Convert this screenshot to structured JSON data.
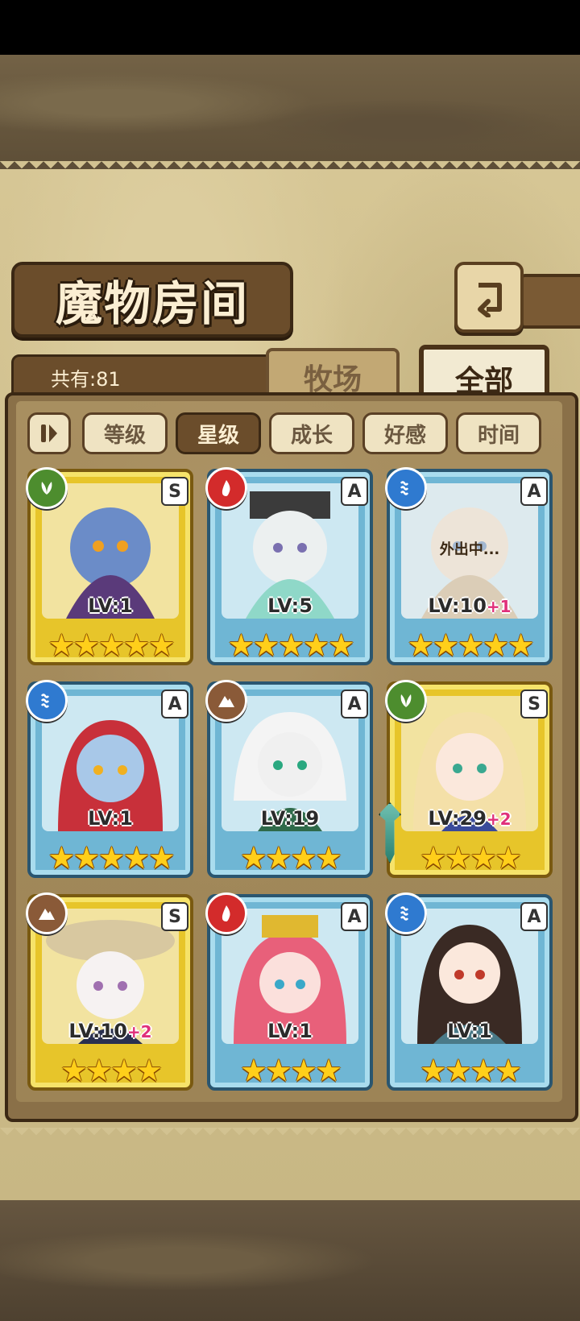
{
  "header": {
    "title": "魔物房间"
  },
  "count_label": "共有:81",
  "tabs": [
    {
      "label": "牧场",
      "active": false
    },
    {
      "label": "全部",
      "active": true
    }
  ],
  "sort_buttons": [
    {
      "label": "等级",
      "active": false
    },
    {
      "label": "星级",
      "active": true
    },
    {
      "label": "成长",
      "active": false
    },
    {
      "label": "好感",
      "active": false
    },
    {
      "label": "时间",
      "active": false
    }
  ],
  "monsters": [
    {
      "element": "grass",
      "rank": "S",
      "frame": "gold",
      "level": "LV:1",
      "plus": "",
      "stars": 5,
      "status": ""
    },
    {
      "element": "fire",
      "rank": "A",
      "frame": "blue",
      "level": "LV:5",
      "plus": "",
      "stars": 5,
      "status": ""
    },
    {
      "element": "water",
      "rank": "A",
      "frame": "blue",
      "level": "LV:10",
      "plus": "+1",
      "stars": 5,
      "status": "外出中..."
    },
    {
      "element": "water",
      "rank": "A",
      "frame": "blue",
      "level": "LV:1",
      "plus": "",
      "stars": 5,
      "status": ""
    },
    {
      "element": "earth",
      "rank": "A",
      "frame": "blue",
      "level": "LV:19",
      "plus": "",
      "stars": 4,
      "status": ""
    },
    {
      "element": "grass",
      "rank": "S",
      "frame": "gold",
      "level": "LV:29",
      "plus": "+2",
      "stars": 4,
      "status": ""
    },
    {
      "element": "earth",
      "rank": "S",
      "frame": "gold",
      "level": "LV:10",
      "plus": "+2",
      "stars": 4,
      "status": ""
    },
    {
      "element": "fire",
      "rank": "A",
      "frame": "blue",
      "level": "LV:1",
      "plus": "",
      "stars": 4,
      "status": ""
    },
    {
      "element": "water",
      "rank": "A",
      "frame": "blue",
      "level": "LV:1",
      "plus": "",
      "stars": 4,
      "status": ""
    }
  ],
  "colors": {
    "gold_frame": "#e7c52a",
    "blue_frame": "#6fb6d4",
    "plus_text": "#e0307a",
    "star": "#ffcf1a"
  }
}
